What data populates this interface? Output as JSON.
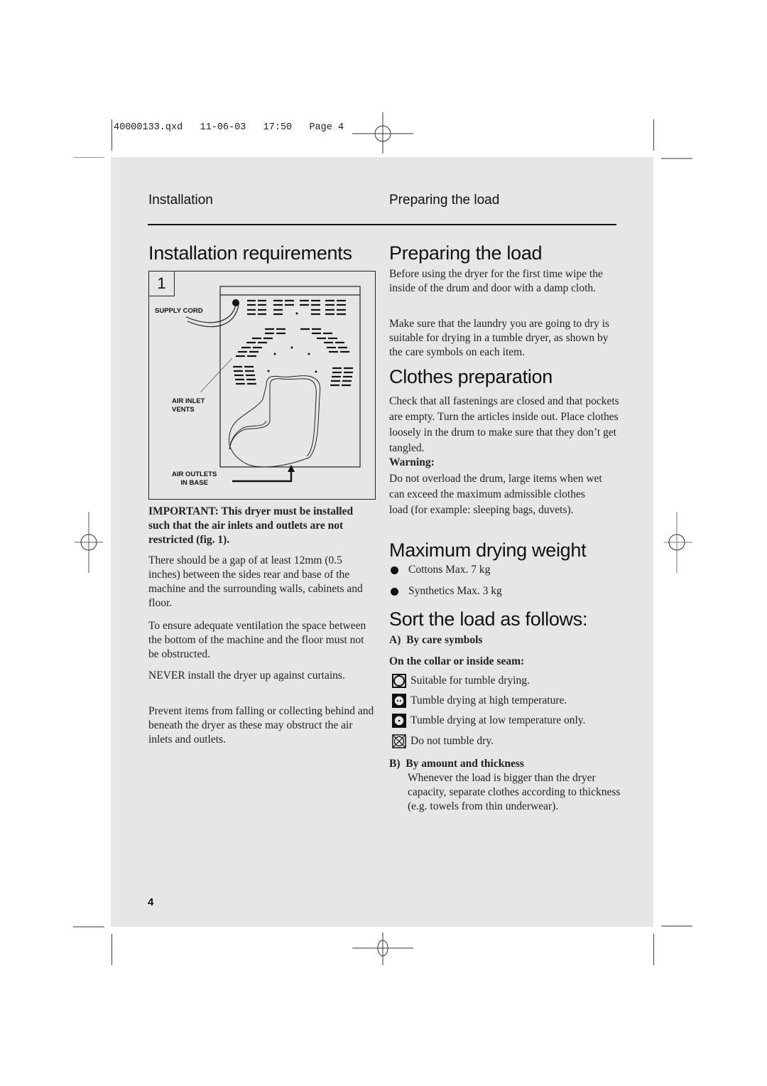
{
  "slug": "40000133.qxd   11-06-03   17:50   Page 4",
  "running_head": {
    "left": "Installation",
    "right": "Preparing the load"
  },
  "left_column": {
    "heading": "Installation requirements",
    "figure": {
      "number": "1",
      "labels": {
        "supply_cord": "SUPPLY CORD",
        "air_inlet_1": "AIR INLET",
        "air_inlet_2": "VENTS",
        "air_outlets_1": "AIR OUTLETS",
        "air_outlets_2": "IN BASE"
      }
    },
    "important": "IMPORTANT: This dryer must be installed such that the air inlets and outlets are not restricted (fig. 1).",
    "para1": "There should be a gap of at least 12mm (0.5 inches) between the sides rear and base of the machine and the surrounding walls, cabinets and floor.",
    "para2": "To ensure adequate ventilation the space between the bottom of the machine and the floor must not be obstructed.",
    "para3": "NEVER install the dryer up against curtains.",
    "para4": "Prevent items from falling or collecting behind and beneath the dryer as these may obstruct the air inlets and outlets."
  },
  "right_column": {
    "preparing": {
      "heading": "Preparing the load",
      "para1": "Before using the dryer for the first time wipe the inside of the drum and door with a damp cloth.",
      "para2": "Make sure that the laundry you are going to dry is suitable for drying in a tumble dryer, as shown by the care symbols on each item."
    },
    "clothes": {
      "heading": "Clothes preparation",
      "para": "Check that all fastenings are closed and that pockets are empty. Turn the articles inside out. Place clothes loosely in the drum to make sure that they don’t get tangled.",
      "warning_label": "Warning:",
      "warning_text": "Do not overload the drum, large items when wet can exceed the maximum admissible clothes load (for example: sleeping bags, duvets)."
    },
    "max_weight": {
      "heading": "Maximum drying weight",
      "items": [
        "Cottons Max. 7 kg",
        "Synthetics Max. 3 kg"
      ]
    },
    "sort": {
      "heading": "Sort the load as follows:",
      "a_label": "A)  By care symbols",
      "collar_label": "On the collar or inside seam:",
      "symbols": [
        {
          "icon": "tumble-dry-icon",
          "text": "Suitable for tumble drying."
        },
        {
          "icon": "tumble-dry-high-icon",
          "text": "Tumble drying at high temperature."
        },
        {
          "icon": "tumble-dry-low-icon",
          "text": "Tumble drying at low temperature only."
        },
        {
          "icon": "do-not-tumble-dry-icon",
          "text": "Do not tumble dry."
        }
      ],
      "b_label": "B)  By amount and thickness",
      "b_text": "Whenever the load is bigger than the dryer capacity, separate clothes according to thickness (e.g. towels from thin underwear)."
    }
  },
  "page_number": "4"
}
